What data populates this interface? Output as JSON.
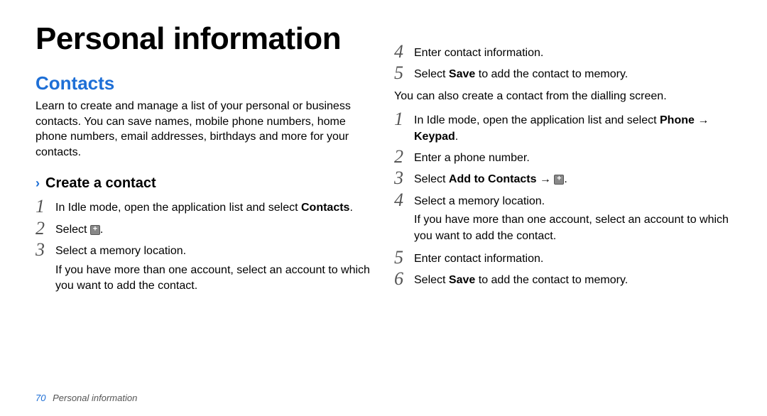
{
  "title": "Personal information",
  "section": "Contacts",
  "intro": "Learn to create and manage a list of your personal or business contacts. You can save names, mobile phone numbers, home phone numbers, email addresses, birthdays and more for your contacts.",
  "subsection_chevron": "›",
  "subsection": "Create a contact",
  "left_steps": {
    "s1_a": "In Idle mode, open the application list and select ",
    "s1_b": "Contacts",
    "s1_c": ".",
    "s2_a": "Select ",
    "s2_b": ".",
    "s3": "Select a memory location.",
    "s3_sub": "If you have more than one account, select an account to which you want to add the contact."
  },
  "right_steps_top": {
    "s4": "Enter contact information.",
    "s5_a": "Select ",
    "s5_b": "Save",
    "s5_c": " to add the contact to memory."
  },
  "continuation": "You can also create a contact from the dialling screen.",
  "right_steps_bottom": {
    "s1_a": "In Idle mode, open the application list and select ",
    "s1_b": "Phone",
    "s1_arrow": " → ",
    "s1_c": "Keypad",
    "s1_d": ".",
    "s2": "Enter a phone number.",
    "s3_a": "Select ",
    "s3_b": "Add to Contacts",
    "s3_arrow": " → ",
    "s3_c": ".",
    "s4": "Select a memory location.",
    "s4_sub": "If you have more than one account, select an account to which you want to add the contact.",
    "s5": "Enter contact information.",
    "s6_a": "Select ",
    "s6_b": "Save",
    "s6_c": " to add the contact to memory."
  },
  "footer_page": "70",
  "footer_text": "Personal information",
  "nums": {
    "n1": "1",
    "n2": "2",
    "n3": "3",
    "n4": "4",
    "n5": "5",
    "n6": "6"
  }
}
